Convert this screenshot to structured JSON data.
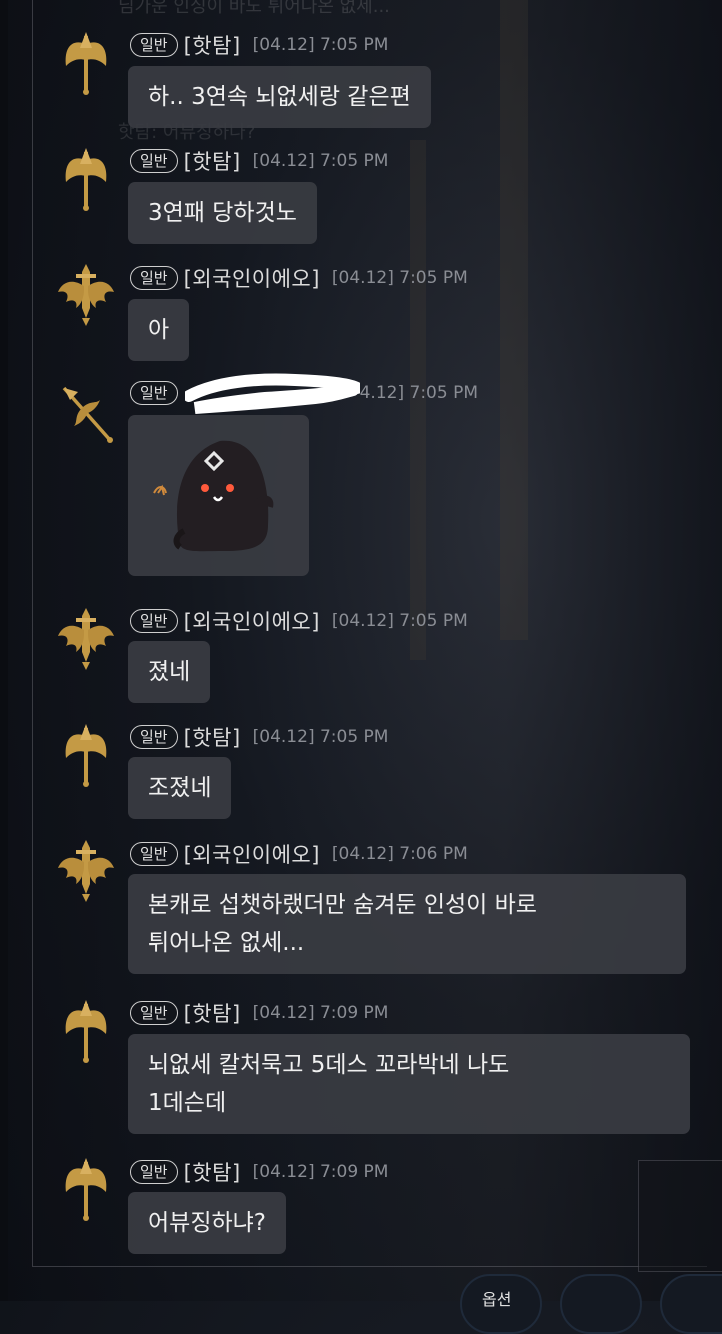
{
  "colors": {
    "bubble": "#3a3c42",
    "name": "#dcdcdc",
    "time": "#8a8d94",
    "emblem_gold": "#c49a45"
  },
  "ghost_text": {
    "top": "님가운 인싱이 바도 튀어나온 없세...",
    "mid": "핫탐: 어뷰징하나?"
  },
  "messages": [
    {
      "badge": "일반",
      "name": "[핫탐]",
      "time": "[04.12] 7:05 PM",
      "icon": "axe-emblem-icon",
      "lines": [
        "하.. 3연속 뇌없세랑 같은편"
      ]
    },
    {
      "badge": "일반",
      "name": "[핫탐]",
      "time": "[04.12] 7:05 PM",
      "icon": "axe-emblem-icon",
      "lines": [
        "3연패 당하것노"
      ]
    },
    {
      "badge": "일반",
      "name": "[외국인이에오]",
      "time": "[04.12] 7:05 PM",
      "icon": "winged-sword-emblem-icon",
      "lines": [
        "아"
      ]
    },
    {
      "badge": "일반",
      "name": "",
      "time": "[04.12] 7:05 PM",
      "time_visible": "4.12] 7:05 PM",
      "icon": "spear-emblem-icon",
      "lines": [],
      "sticker": "ghost-sticker-icon"
    },
    {
      "badge": "일반",
      "name": "[외국인이에오]",
      "time": "[04.12] 7:05 PM",
      "icon": "winged-sword-emblem-icon",
      "lines": [
        "졌네"
      ]
    },
    {
      "badge": "일반",
      "name": "[핫탐]",
      "time": "[04.12] 7:05 PM",
      "icon": "axe-emblem-icon",
      "lines": [
        "조졌네"
      ]
    },
    {
      "badge": "일반",
      "name": "[외국인이에오]",
      "time": "[04.12] 7:06 PM",
      "icon": "winged-sword-emblem-icon",
      "lines": [
        "본캐로 섭챗하랬더만 숨겨둔 인성이 바로",
        "튀어나온 없세..."
      ]
    },
    {
      "badge": "일반",
      "name": "[핫탐]",
      "time": "[04.12] 7:09 PM",
      "icon": "axe-emblem-icon",
      "lines": [
        "뇌없세 칼처묵고 5데스 꼬라박네 나도",
        "1데슨데"
      ]
    },
    {
      "badge": "일반",
      "name": "[핫탐]",
      "time": "[04.12] 7:09 PM",
      "icon": "axe-emblem-icon",
      "lines": [
        "어뷰징하냐?"
      ]
    }
  ],
  "bottom_bar": {
    "option_label": "옵션"
  }
}
